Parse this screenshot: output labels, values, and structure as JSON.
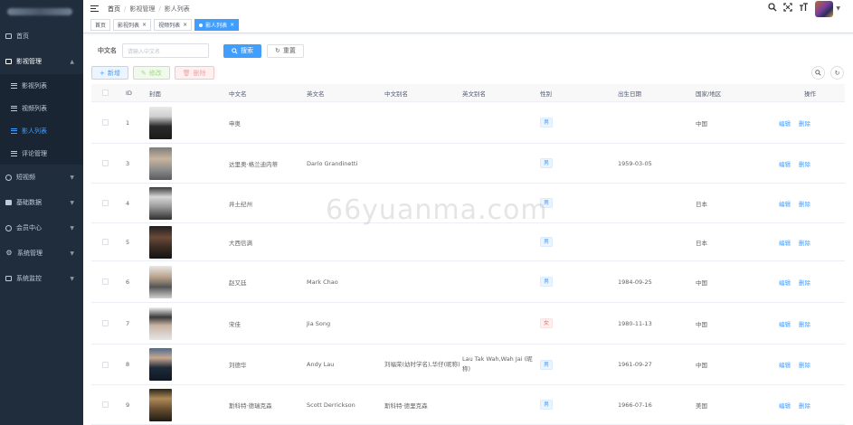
{
  "sidebar": {
    "items": [
      {
        "label": "首页",
        "icon": "home-icon"
      },
      {
        "label": "影视管理",
        "icon": "film-icon",
        "open": true,
        "children": [
          {
            "label": "影视列表"
          },
          {
            "label": "视频列表"
          },
          {
            "label": "影人列表",
            "active": true
          },
          {
            "label": "评论管理"
          }
        ]
      },
      {
        "label": "短视频",
        "icon": "video-icon"
      },
      {
        "label": "基础数据",
        "icon": "folder-icon"
      },
      {
        "label": "会员中心",
        "icon": "user-icon"
      },
      {
        "label": "系统管理",
        "icon": "gear-icon"
      },
      {
        "label": "系统监控",
        "icon": "monitor-icon"
      }
    ]
  },
  "header": {
    "breadcrumb": [
      "首页",
      "影视管理",
      "影人列表"
    ]
  },
  "tags": [
    {
      "label": "首页",
      "closable": false
    },
    {
      "label": "影视列表",
      "closable": true
    },
    {
      "label": "视频列表",
      "closable": true
    },
    {
      "label": "影人列表",
      "closable": true,
      "active": true
    }
  ],
  "search": {
    "label": "中文名",
    "placeholder": "请输入中文名",
    "search_button": "搜索",
    "reset_button": "重置"
  },
  "toolbar": {
    "add": "新增",
    "edit": "修改",
    "delete": "删除"
  },
  "table": {
    "columns": [
      "ID",
      "封面",
      "中文名",
      "英文名",
      "中文别名",
      "英文别名",
      "性别",
      "出生日期",
      "国家/地区",
      "操作"
    ],
    "rows": [
      {
        "id": "1",
        "name": "申奥",
        "en": "",
        "alias": "",
        "en_alias": "",
        "gender": "男",
        "birth": "",
        "country": "中国"
      },
      {
        "id": "3",
        "name": "达里奥·格兰迪内蒂",
        "en": "Darío Grandinetti",
        "alias": "",
        "en_alias": "",
        "gender": "男",
        "birth": "1959-03-05",
        "country": ""
      },
      {
        "id": "4",
        "name": "井土纪州",
        "en": "",
        "alias": "",
        "en_alias": "",
        "gender": "男",
        "birth": "",
        "country": "日本"
      },
      {
        "id": "5",
        "name": "大西信满",
        "en": "",
        "alias": "",
        "en_alias": "",
        "gender": "男",
        "birth": "",
        "country": "日本"
      },
      {
        "id": "6",
        "name": "赵又廷",
        "en": "Mark Chao",
        "alias": "",
        "en_alias": "",
        "gender": "男",
        "birth": "1984-09-25",
        "country": "中国"
      },
      {
        "id": "7",
        "name": "宋佳",
        "en": "Jia Song",
        "alias": "",
        "en_alias": "",
        "gender": "女",
        "birth": "1980-11-13",
        "country": "中国"
      },
      {
        "id": "8",
        "name": "刘德华",
        "en": "Andy Lau",
        "alias": "刘福荣(幼时学名),华仔(昵称)",
        "en_alias": "Lau Tak Wah,Wah Jai (昵称)",
        "gender": "男",
        "birth": "1961-09-27",
        "country": "中国"
      },
      {
        "id": "9",
        "name": "斯科特·德瑞克森",
        "en": "Scott Derrickson",
        "alias": "斯科特·德里克森",
        "en_alias": "",
        "gender": "男",
        "birth": "1966-07-16",
        "country": "美国"
      }
    ],
    "op_edit": "编辑",
    "op_delete": "删除"
  },
  "watermark": "66yuanma.com",
  "colors": {
    "primary": "#409eff",
    "sidebar_bg": "#1f2d3d",
    "danger": "#f56c6c"
  }
}
